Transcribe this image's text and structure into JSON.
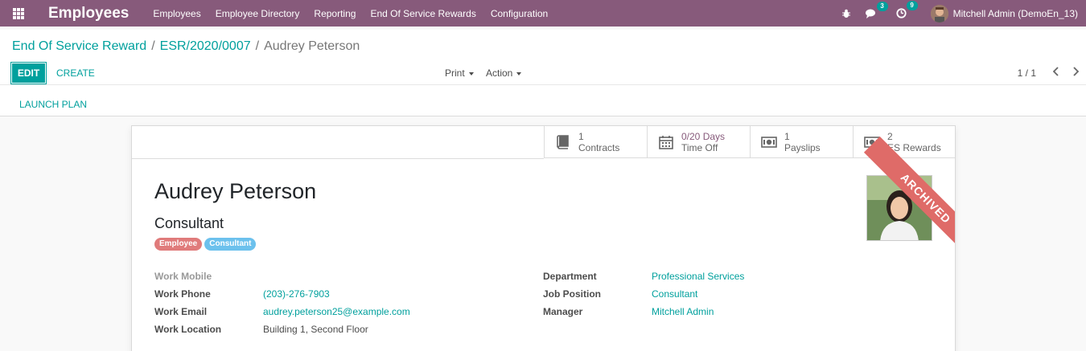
{
  "navbar": {
    "app_title": "Employees",
    "menu": [
      "Employees",
      "Employee Directory",
      "Reporting",
      "End Of Service Rewards",
      "Configuration"
    ],
    "messages_count": "3",
    "activities_count": "9",
    "user_name": "Mitchell Admin (DemoEn_13)",
    "color": "#875a7b"
  },
  "breadcrumb": {
    "items": [
      "End Of Service Reward",
      "ESR/2020/0007"
    ],
    "current": "Audrey Peterson"
  },
  "buttons": {
    "edit": "EDIT",
    "create": "CREATE",
    "print": "Print",
    "action": "Action",
    "launch_plan": "LAUNCH PLAN"
  },
  "pager": {
    "value": "1 / 1"
  },
  "smart_buttons": [
    {
      "value": "1",
      "label": "Contracts",
      "icon": "book-icon"
    },
    {
      "value": "0/20 Days",
      "label": "Time Off",
      "icon": "calendar-icon"
    },
    {
      "value": "1",
      "label": "Payslips",
      "icon": "money-icon"
    },
    {
      "value": "2",
      "label": "ES Rewards",
      "icon": "money-icon"
    }
  ],
  "employee": {
    "name": "Audrey Peterson",
    "job_title": "Consultant",
    "tags": [
      {
        "label": "Employee",
        "color": "#e07b7b"
      },
      {
        "label": "Consultant",
        "color": "#6cc1ed"
      }
    ],
    "ribbon": "ARCHIVED"
  },
  "fields_left": [
    {
      "label": "Work Mobile",
      "value": ""
    },
    {
      "label": "Work Phone",
      "value": "(203)-276-7903"
    },
    {
      "label": "Work Email",
      "value": "audrey.peterson25@example.com"
    },
    {
      "label": "Work Location",
      "value": "Building 1, Second Floor"
    }
  ],
  "fields_right": [
    {
      "label": "Department",
      "value": "Professional Services"
    },
    {
      "label": "Job Position",
      "value": "Consultant"
    },
    {
      "label": "Manager",
      "value": "Mitchell Admin"
    }
  ],
  "colors": {
    "accent": "#00a09d",
    "ribbon": "#df6b68"
  }
}
